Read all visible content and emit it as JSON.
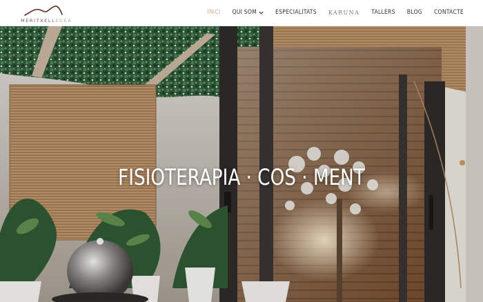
{
  "brand": {
    "name_part1": "MERITXELL",
    "name_part2": "EGEA"
  },
  "nav": {
    "items": [
      {
        "label": "INICI",
        "active": true
      },
      {
        "label": "QUI SOM",
        "has_dropdown": true
      },
      {
        "label": "ESPECIALITATS"
      },
      {
        "label": "KARUNA"
      },
      {
        "label": "TALLERS"
      },
      {
        "label": "BLOG"
      },
      {
        "label": "CONTACTE"
      }
    ]
  },
  "hero": {
    "headline": "FISIOTERAPIA · COS · MENT"
  },
  "colors": {
    "accent": "#d8a98f",
    "text": "#3a2f2a",
    "logo": "#6b5b53"
  }
}
